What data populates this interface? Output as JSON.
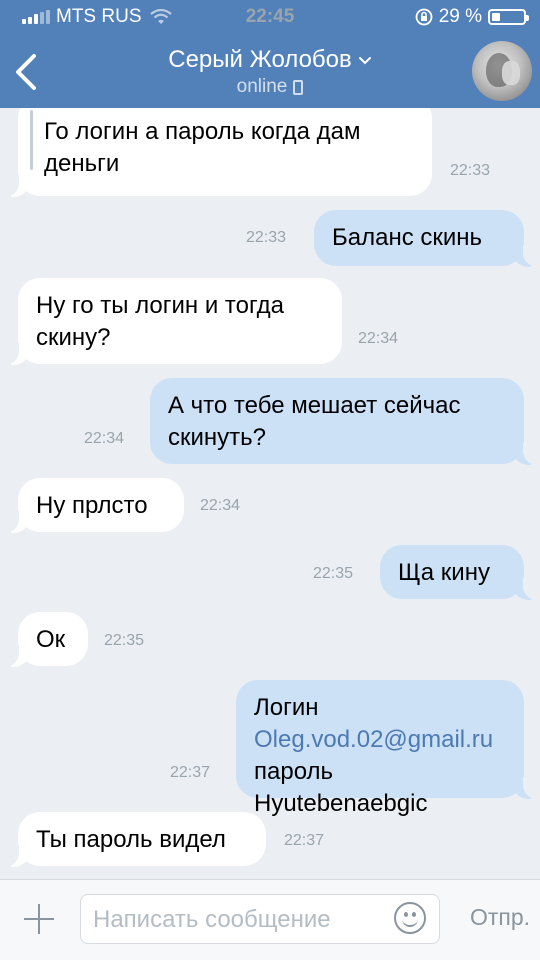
{
  "status_bar": {
    "carrier": "MTS RUS",
    "time": "22:45",
    "battery": "29 %"
  },
  "header": {
    "name": "Серый Жолобов",
    "status": "online"
  },
  "messages": [
    {
      "dir": "in",
      "text": "Го логин а пароль когда дам деньги",
      "time": "22:33"
    },
    {
      "dir": "out",
      "text": "Баланс скинь",
      "time": "22:33"
    },
    {
      "dir": "in",
      "text": "Ну го ты логин и тогда скину?",
      "time": "22:34"
    },
    {
      "dir": "out",
      "text": "А что тебе мешает сейчас скинуть?",
      "time": "22:34"
    },
    {
      "dir": "in",
      "text": "Ну прлсто",
      "time": "22:34"
    },
    {
      "dir": "out",
      "text": "Ща кину",
      "time": "22:35"
    },
    {
      "dir": "in",
      "text": "Ок",
      "time": "22:35"
    },
    {
      "dir": "out",
      "text_prefix": "Логин ",
      "link": "Oleg.vod.02@gmail.ru",
      "text_suffix": " пароль Hyutebenaebgic",
      "time": "22:37"
    },
    {
      "dir": "in",
      "text": "Ты пароль видел",
      "time": "22:37"
    }
  ],
  "composer": {
    "placeholder": "Написать сообщение",
    "send_label": "Отпр."
  },
  "colors": {
    "header": "#5181b8",
    "out_bubble": "#cce0f6",
    "in_bubble": "#ffffff",
    "background": "#ebeff3",
    "link": "#4c7ab3"
  }
}
